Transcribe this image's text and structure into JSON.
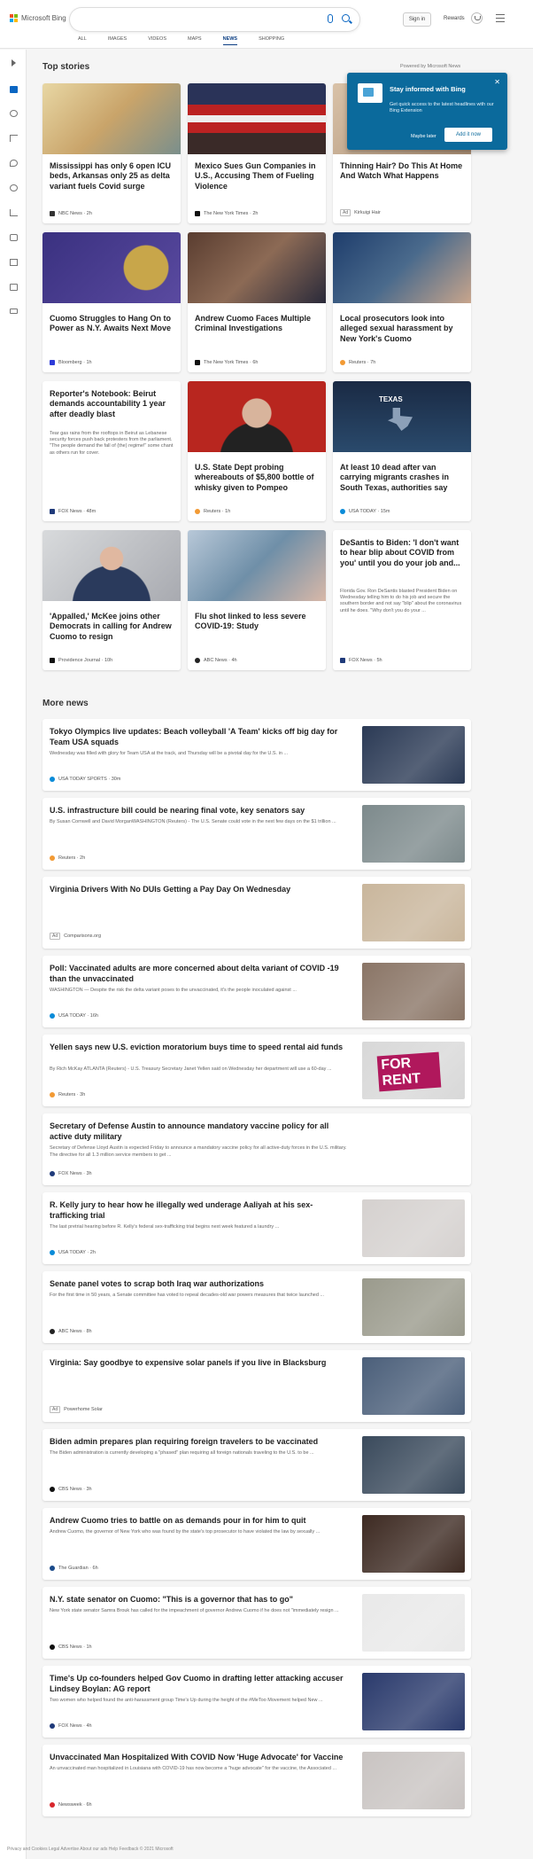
{
  "header": {
    "brand": "Microsoft Bing",
    "signin": "Sign in",
    "rewards": "Rewards",
    "tabs": [
      "ALL",
      "IMAGES",
      "VIDEOS",
      "MAPS",
      "NEWS",
      "SHOPPING"
    ],
    "active_tab": "NEWS"
  },
  "top_stories": {
    "heading": "Top stories",
    "powered": "Powered by Microsoft News",
    "cards": [
      {
        "title": "Mississippi has only 6 open ICU beds, Arkansas only 25 as delta variant fuels Covid surge",
        "source": "NBC News",
        "time": "2h",
        "color": "#c9a46a"
      },
      {
        "title": "Mexico Sues Gun Companies in U.S., Accusing Them of Fueling Violence",
        "source": "The New York Times",
        "time": "2h",
        "color": "#5a4a48"
      },
      {
        "title": "Thinning Hair? Do This At Home And Watch What Happens",
        "source": "Kirkuigi Hair",
        "ad": "Ad",
        "color": "#c4a78c"
      },
      {
        "title": "Cuomo Struggles to Hang On to Power as N.Y. Awaits Next Move",
        "source": "Bloomberg",
        "time": "1h",
        "color": "#3a3180"
      },
      {
        "title": "Andrew Cuomo Faces Multiple Criminal Investigations",
        "source": "The New York Times",
        "time": "6h",
        "color": "#6a5346"
      },
      {
        "title": "Local prosecutors look into alleged sexual harassment by New York's Cuomo",
        "source": "Reuters",
        "time": "7h",
        "color": "#4a6a8c"
      },
      {
        "title": "Reporter's Notebook: Beirut demands accountability 1 year after deadly blast",
        "summary": "Tear gas rains from the rooftops in Beirut as Lebanese security forces push back protesters from the parliament. \"The people demand the fall of (the) regime!\" some chant as others run for cover.",
        "source": "FOX News",
        "time": "48m"
      },
      {
        "title": "U.S. State Dept probing whereabouts of $5,800 bottle of whisky given to Pompeo",
        "source": "Reuters",
        "time": "1h",
        "color": "#b8261f"
      },
      {
        "title": "At least 10 dead after van carrying migrants crashes in South Texas, authorities say",
        "source": "USA TODAY",
        "time": "15m",
        "color": "#1e3450",
        "image_text": "TEXAS"
      },
      {
        "title": "'Appalled,' McKee joins other Democrats in calling for Andrew Cuomo to resign",
        "source": "Providence Journal",
        "time": "10h",
        "color": "#a8aab0"
      },
      {
        "title": "Flu shot linked to less severe COVID-19: Study",
        "source": "ABC News",
        "time": "4h",
        "color": "#6f8fa8"
      },
      {
        "title": "DeSantis to Biden: 'I don't want to hear blip about COVID from you' until you do your job and...",
        "summary": "Florida Gov. Ron DeSantis blasted President Biden on Wednesday telling him to do his job and secure the southern border and not say \"blip\" about the coronavirus until he does. \"Why don't you do your ...",
        "source": "FOX News",
        "time": "5h"
      }
    ]
  },
  "popup": {
    "title": "Stay informed with Bing",
    "text": "Get quick access to the latest headlines with our Bing Extension",
    "later": "Maybe later",
    "add": "Add it now"
  },
  "more_news": {
    "heading": "More news",
    "items": [
      {
        "title": "Tokyo Olympics live updates: Beach volleyball 'A Team' kicks off big day for Team USA squads",
        "summary": "Wednesday was filled with glory for Team USA at the track, and Thursday will be a pivotal day for the U.S. in ...",
        "source": "USA TODAY SPORTS",
        "time": "30m",
        "color": "#2b3a55"
      },
      {
        "title": "U.S. infrastructure bill could be nearing final vote, key senators say",
        "summary": "By Susan Cornwell and David MorganWASHINGTON (Reuters) - The U.S. Senate could vote in the next few days on the $1 trillion ...",
        "source": "Reuters",
        "time": "2h",
        "color": "#7d8a8c"
      },
      {
        "title": "Virginia Drivers With No DUIs Getting a Pay Day On Wednesday",
        "source": "Comparisons.org",
        "ad": "Ad",
        "color": "#c9b69c"
      },
      {
        "title": "Poll: Vaccinated adults are more concerned about delta variant of COVID -19 than the unvaccinated",
        "summary": "WASHINGTON — Despite the risk the delta variant poses to the unvaccinated, it's the people inoculated against ...",
        "source": "USA TODAY",
        "time": "16h",
        "color": "#8a7566"
      },
      {
        "title": "Yellen says new U.S. eviction moratorium buys time to speed rental aid funds",
        "summary": "By Rich McKay ATLANTA (Reuters) - U.S. Treasury Secretary Janet Yellen said on Wednesday her department will use a 60-day ...",
        "source": "Reuters",
        "time": "3h",
        "color": "#d8d8d8",
        "image_text": "FOR RENT"
      },
      {
        "title": "Secretary of Defense Austin to announce mandatory vaccine policy for all active duty military",
        "summary": "Secretary of Defense Lloyd Austin is expected Friday to announce a mandatory vaccine policy for all active-duty forces in the U.S. military. The directive for all 1.3 million service members to get ...",
        "source": "FOX News",
        "time": "3h"
      },
      {
        "title": "R. Kelly jury to hear how he illegally wed underage Aaliyah at his sex-trafficking trial",
        "summary": "The last pretrial hearing before R. Kelly's federal sex-trafficking trial begins next week featured a laundry ...",
        "source": "USA TODAY",
        "time": "2h",
        "color": "#d5d1cf"
      },
      {
        "title": "Senate panel votes to scrap both Iraq war authorizations",
        "summary": "For the first time in 50 years, a Senate committee has voted to repeal decades-old war powers measures that twice launched ...",
        "source": "ABC News",
        "time": "8h",
        "color": "#9a9a8c"
      },
      {
        "title": "Virginia: Say goodbye to expensive solar panels if you live in Blacksburg",
        "source": "Powerhome Solar",
        "ad": "Ad",
        "color": "#4b5f7a"
      },
      {
        "title": "Biden admin prepares plan requiring foreign travelers to be vaccinated",
        "summary": "The Biden administration is currently developing a \"phased\" plan requiring all foreign nationals traveling to the U.S. to be ...",
        "source": "CBS News",
        "time": "3h",
        "color": "#3a4a5c"
      },
      {
        "title": "Andrew Cuomo tries to battle on as demands pour in for him to quit",
        "summary": "Andrew Cuomo, the governor of New York who was found by the state's top prosecutor to have violated the law by sexually ...",
        "source": "The Guardian",
        "time": "6h",
        "color": "#3d2a22"
      },
      {
        "title": "N.Y. state senator on Cuomo: \"This is a governor that has to go\"",
        "summary": "New York state senator Samra Brouk has called for the impeachment of governor Andrew Cuomo if he does not \"immediately resign ...",
        "source": "CBS News",
        "time": "1h",
        "color": "#e9e9e9"
      },
      {
        "title": "Time's Up co-founders helped Gov Cuomo in drafting letter attacking accuser Lindsey Boylan: AG report",
        "summary": "Two women who helped found the anti-harassment group Time's Up during the height of the #MeToo Movement helped New ...",
        "source": "FOX News",
        "time": "4h",
        "color": "#2a3a6c"
      },
      {
        "title": "Unvaccinated Man Hospitalized With COVID Now 'Huge Advocate' for Vaccine",
        "summary": "An unvaccinated man hospitalized in Louisiana with COVID-19 has now become a \"huge advocate\" for the vaccine, the Associated ...",
        "source": "Newsweek",
        "time": "6h",
        "color": "#c9c4c2"
      }
    ]
  },
  "footer": "Privacy and Cookies   Legal   Advertise   About our ads   Help   Feedback   © 2021 Microsoft"
}
